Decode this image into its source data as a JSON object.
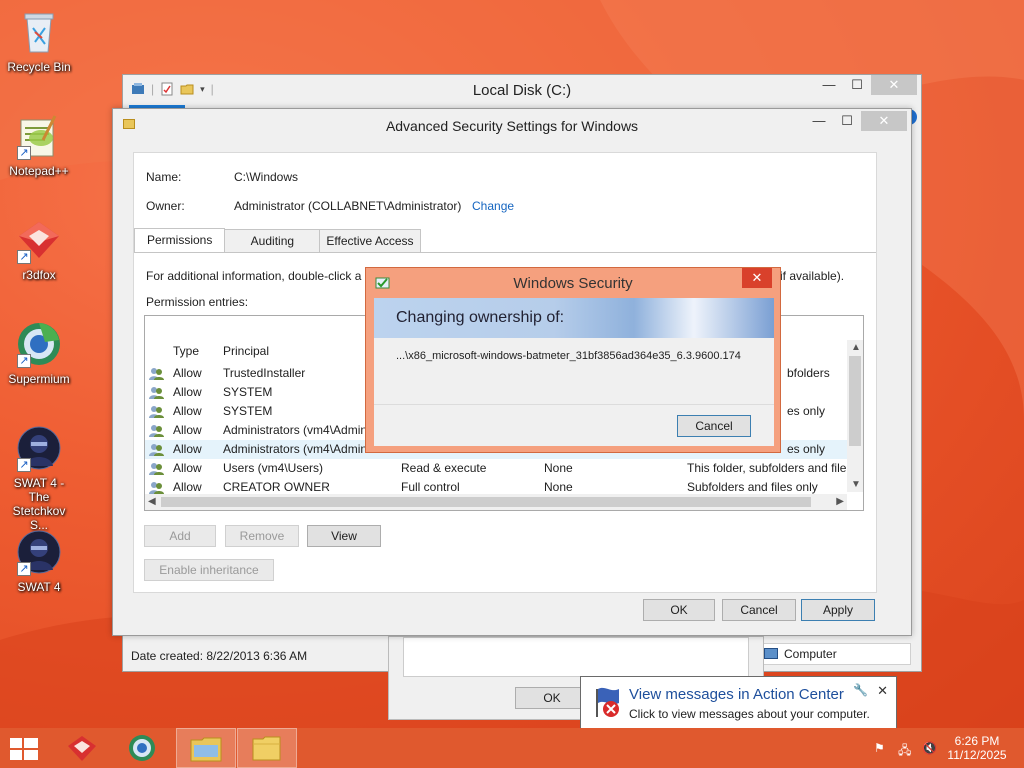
{
  "desktop": {
    "icons": [
      {
        "label": "Recycle Bin",
        "icon": "recycle-bin-icon"
      },
      {
        "label": "Notepad++",
        "icon": "notepad-plus-plus-icon"
      },
      {
        "label": "r3dfox",
        "icon": "r3dfox-icon"
      },
      {
        "label": "Supermium",
        "icon": "supermium-icon"
      },
      {
        "label": "SWAT 4 - The Stetchkov S...",
        "icon": "swat4-expansion-icon"
      },
      {
        "label": "SWAT 4",
        "icon": "swat4-icon"
      }
    ]
  },
  "explorer": {
    "title": "Local Disk (C:)",
    "status": "Date created: 8/22/2013 6:36 AM",
    "nav_item": "Computer",
    "help": "?"
  },
  "under_dialog": {
    "ok_label": "OK"
  },
  "advanced": {
    "title": "Advanced Security Settings for Windows",
    "name_label": "Name:",
    "name_value": "C:\\Windows",
    "owner_label": "Owner:",
    "owner_value": "Administrator (COLLABNET\\Administrator)",
    "change_link": "Change",
    "tabs": [
      "Permissions",
      "Auditing",
      "Effective Access"
    ],
    "info_left": "For additional information, double-click a",
    "info_right": "if available).",
    "entries_label": "Permission entries:",
    "columns": {
      "type": "Type",
      "principal": "Principal"
    },
    "rows": [
      {
        "type": "Allow",
        "principal": "TrustedInstaller",
        "access": "",
        "inherited": "",
        "applies": "bfolders"
      },
      {
        "type": "Allow",
        "principal": "SYSTEM",
        "access": "",
        "inherited": "",
        "applies": ""
      },
      {
        "type": "Allow",
        "principal": "SYSTEM",
        "access": "",
        "inherited": "",
        "applies": "es only"
      },
      {
        "type": "Allow",
        "principal": "Administrators (vm4\\Admin",
        "access": "",
        "inherited": "",
        "applies": ""
      },
      {
        "type": "Allow",
        "principal": "Administrators (vm4\\Admin",
        "access": "",
        "inherited": "",
        "applies": "es only"
      },
      {
        "type": "Allow",
        "principal": "Users (vm4\\Users)",
        "access": "Read & execute",
        "inherited": "None",
        "applies": "This folder, subfolders and file"
      },
      {
        "type": "Allow",
        "principal": "CREATOR OWNER",
        "access": "Full control",
        "inherited": "None",
        "applies": "Subfolders and files only"
      }
    ],
    "buttons": {
      "add": "Add",
      "remove": "Remove",
      "view": "View",
      "enable_inheritance": "Enable inheritance",
      "ok": "OK",
      "cancel": "Cancel",
      "apply": "Apply"
    }
  },
  "security": {
    "title": "Windows Security",
    "close": "✕",
    "banner": "Changing ownership of:",
    "path": "...\\x86_microsoft-windows-batmeter_31bf3856ad364e35_6.3.9600.174",
    "cancel": "Cancel"
  },
  "balloon": {
    "title": "View messages in Action Center",
    "text": "Click to view messages about your computer.",
    "close": "✕"
  },
  "taskbar": {
    "time": "6:26 PM",
    "date": "11/12/2025",
    "pinned": [
      "r3dfox-icon",
      "supermium-icon",
      "file-explorer-icon",
      "folder-icon"
    ]
  },
  "colors": {
    "accent": "#1565c0",
    "taskbar": "#e0592e",
    "security_frame": "#f5a07e"
  }
}
